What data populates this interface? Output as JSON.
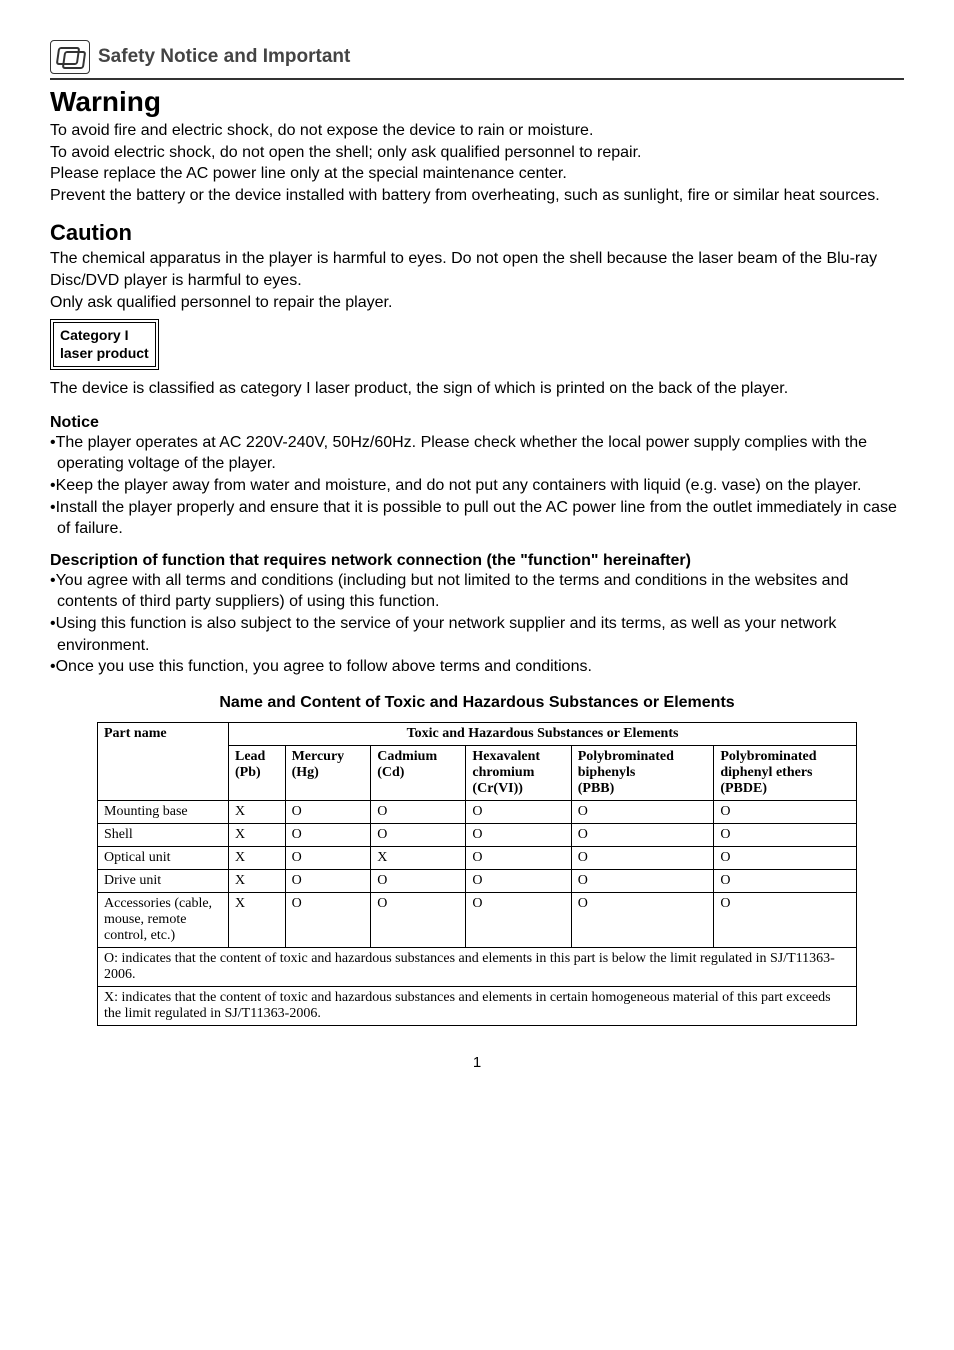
{
  "header": {
    "section_title": "Safety Notice and Important"
  },
  "warning": {
    "heading": "Warning",
    "p1": "To avoid fire and electric shock, do not expose the device to rain or moisture.",
    "p2": "To avoid electric shock, do not open the shell; only ask qualified personnel to repair.",
    "p3": "Please replace the AC power line only at the special maintenance center.",
    "p4": "Prevent the battery or the device installed with battery from overheating, such as sunlight, fire or similar heat sources."
  },
  "caution": {
    "heading": "Caution",
    "p1": "The chemical apparatus in the player is harmful to eyes. Do not open the shell because the laser beam of the Blu-ray Disc/DVD player is harmful to eyes.",
    "p2": "Only ask qualified personnel to repair the player.",
    "laser_box_line1": "Category I",
    "laser_box_line2": "laser product",
    "p3": "The device is classified as category I laser product, the sign of which is printed on the back of the player."
  },
  "notice": {
    "heading": "Notice",
    "b1": "•The player operates at AC 220V-240V, 50Hz/60Hz. Please check whether the local power supply complies with the operating voltage of the player.",
    "b2": "•Keep the player away from water and moisture, and do not put any containers with liquid (e.g. vase) on the player.",
    "b3": "•Install the player properly and ensure that it is possible to pull out the AC power line from the outlet immediately in case of failure."
  },
  "network_func": {
    "heading": "Description of function that requires network connection (the \"function\" hereinafter)",
    "b1": "•You agree with all terms and conditions (including but not limited to the terms and conditions in the websites and contents of third party suppliers) of using this function.",
    "b2": "•Using this function is also subject to the service of your network supplier and its terms, as well as your network environment.",
    "b3": "•Once you use this function, you agree to follow above terms and conditions."
  },
  "table": {
    "title": "Name and Content of Toxic and Hazardous Substances or Elements",
    "part_name_label": "Part name",
    "toxic_header": "Toxic and Hazardous Substances or Elements",
    "cols": {
      "lead_l1": "Lead",
      "lead_l2": "(Pb)",
      "mercury_l1": "Mercury",
      "mercury_l2": "(Hg)",
      "cadmium_l1": "Cadmium",
      "cadmium_l2": "(Cd)",
      "hex_l1": "Hexavalent",
      "hex_l2": "chromium",
      "hex_l3": "(Cr(VI))",
      "pbb_l1": "Polybrominated",
      "pbb_l2": "biphenyls",
      "pbb_l3": "(PBB)",
      "pbde_l1": "Polybrominated",
      "pbde_l2": "diphenyl ethers",
      "pbde_l3": "(PBDE)"
    },
    "rows": [
      {
        "name": "Mounting base",
        "vals": [
          "X",
          "O",
          "O",
          "O",
          "O",
          "O"
        ]
      },
      {
        "name": "Shell",
        "vals": [
          "X",
          "O",
          "O",
          "O",
          "O",
          "O"
        ]
      },
      {
        "name": "Optical unit",
        "vals": [
          "X",
          "O",
          "X",
          "O",
          "O",
          "O"
        ]
      },
      {
        "name": "Drive unit",
        "vals": [
          "X",
          "O",
          "O",
          "O",
          "O",
          "O"
        ]
      },
      {
        "name": "Accessories (cable, mouse, remote control, etc.)",
        "vals": [
          "X",
          "O",
          "O",
          "O",
          "O",
          "O"
        ]
      }
    ],
    "footer1": "O: indicates that the content of toxic and hazardous substances and elements in this part is below the limit regulated in SJ/T11363-2006.",
    "footer2": "X: indicates that the content of toxic and hazardous substances and elements in certain homogeneous material of this part exceeds the limit regulated in SJ/T11363-2006."
  },
  "page_number": "1"
}
